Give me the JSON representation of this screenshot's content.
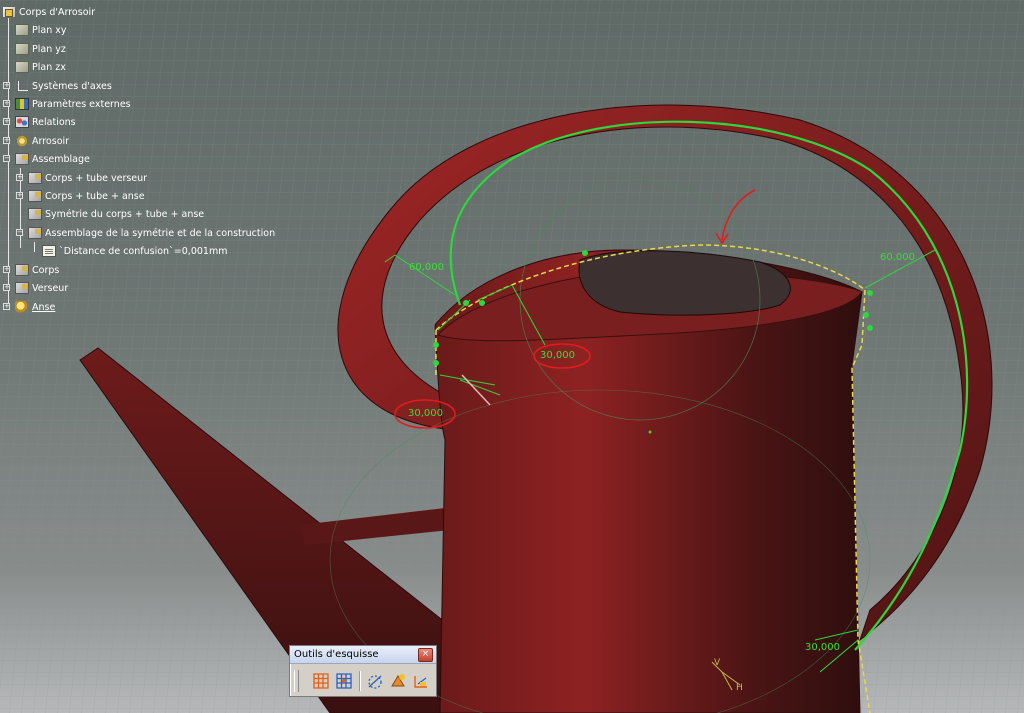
{
  "spec_tree": {
    "root": {
      "label": "Corps d'Arrosoir",
      "icon": "part-icon"
    },
    "items": [
      {
        "label": "Plan xy",
        "icon": "plane-icon"
      },
      {
        "label": "Plan yz",
        "icon": "plane-icon"
      },
      {
        "label": "Plan zx",
        "icon": "plane-icon"
      },
      {
        "label": "Systèmes d'axes",
        "icon": "axis-system-icon"
      },
      {
        "label": "Paramètres externes",
        "icon": "external-parameters-icon"
      },
      {
        "label": "Relations",
        "icon": "relations-icon"
      },
      {
        "label": "Arrosoir",
        "icon": "gear-icon"
      },
      {
        "label": "Assemblage",
        "icon": "assembly-icon"
      },
      {
        "label": "Corps + tube verseur",
        "icon": "assembly-icon"
      },
      {
        "label": "Corps + tube + anse",
        "icon": "assembly-icon"
      },
      {
        "label": "Symétrie du corps + tube + anse",
        "icon": "symmetry-icon"
      },
      {
        "label": "Assemblage de la symétrie et de la construction",
        "icon": "assembly-icon"
      },
      {
        "label": "`Distance de confusion`=0,001mm",
        "icon": "parameter-doc-icon"
      },
      {
        "label": "Corps",
        "icon": "assembly-icon"
      },
      {
        "label": "Verseur",
        "icon": "assembly-icon"
      },
      {
        "label": "Anse",
        "icon": "active-body-icon"
      }
    ]
  },
  "dimensions": {
    "top_left": "60,000",
    "top_right": "60,000",
    "circled_upper": "30,000",
    "circled_lower": "30,000",
    "bottom_right": "30,000"
  },
  "compass": {
    "axis_v": "V",
    "axis_h": "H"
  },
  "toolbar": {
    "title": "Outils d'esquisse",
    "close": "×",
    "tools": [
      "grid-icon",
      "snap-to-point-icon",
      "construction-element-icon",
      "geometrical-constraints-icon",
      "dimensional-constraints-icon"
    ]
  },
  "colors": {
    "sketch_green": "#2cd83c",
    "body_red": "#8b1c1c",
    "highlight_yellow": "#e8d84a",
    "annotation_red": "#e21c1c"
  }
}
